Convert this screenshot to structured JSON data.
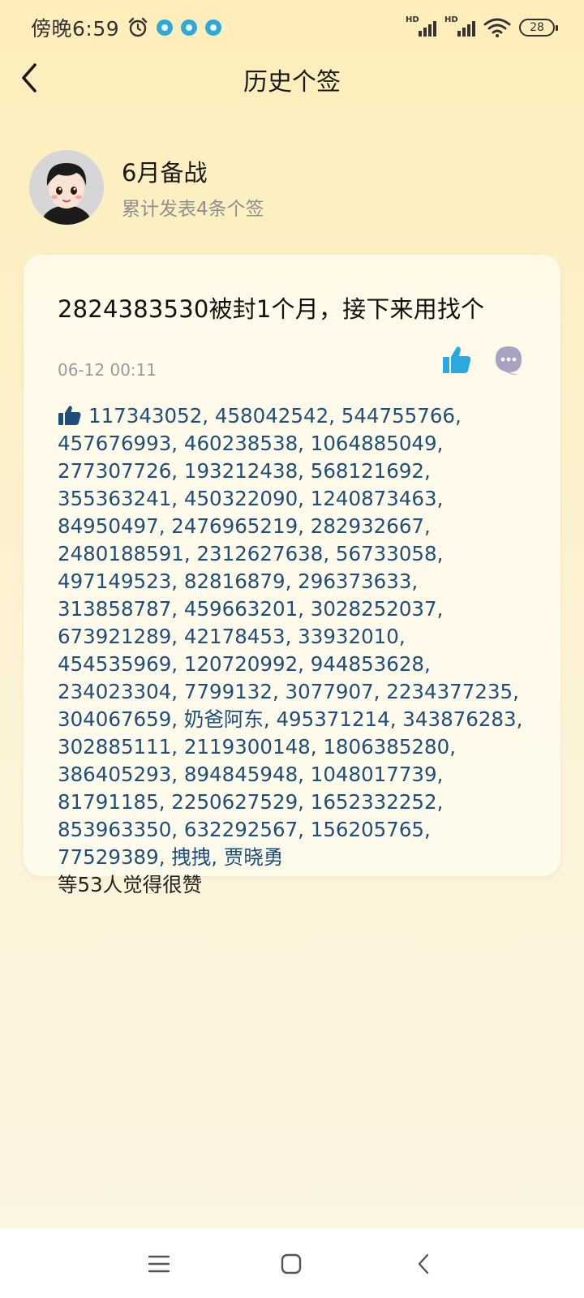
{
  "status_bar": {
    "time": "傍晚6:59",
    "battery": "28",
    "hd_label": "HD",
    "icons": [
      "alarm-icon",
      "app-notification-icon",
      "app-notification-icon",
      "app-notification-icon",
      "signal-icon",
      "signal-icon",
      "wifi-icon",
      "battery-icon"
    ]
  },
  "header": {
    "title": "历史个签",
    "back_icon": "chevron-left-icon"
  },
  "profile": {
    "name": "6月备战",
    "count_text": "累计发表4条个签"
  },
  "signature": {
    "text": "2824383530被封1个月，接下来用找个",
    "time": "06-12 00:11",
    "like_icon": "thumbs-up-icon",
    "comment_icon": "comment-icon",
    "likers_text": "117343052, 458042542, 544755766, 457676993, 460238538, 1064885049, 277307726, 193212438, 568121692, 355363241, 450322090, 1240873463, 84950497, 2476965219, 282932667, 2480188591, 2312627638, 56733058, 497149523, 82816879, 296373633, 313858787, 459663201, 3028252037, 673921289, 42178453, 33932010, 454535969, 120720992, 944853628, 234023304, 7799132, 3077907, 2234377235, 304067659, 奶爸阿东, 495371214, 343876283, 302885111, 2119300148, 1806385280, 386405293, 894845948, 1048017739, 81791185, 2250627529, 1652332252, 853963350, 632292567, 156205765, 77529389, 拽拽, 贾晓勇",
    "likers_suffix": "等53人觉得很赞"
  },
  "colors": {
    "accent_blue": "#2aa9e0",
    "likers_blue": "#1f4e79",
    "muted": "#9a9a9a"
  },
  "nav_bar": {
    "icons": [
      "menu-icon",
      "home-icon",
      "back-icon"
    ]
  }
}
